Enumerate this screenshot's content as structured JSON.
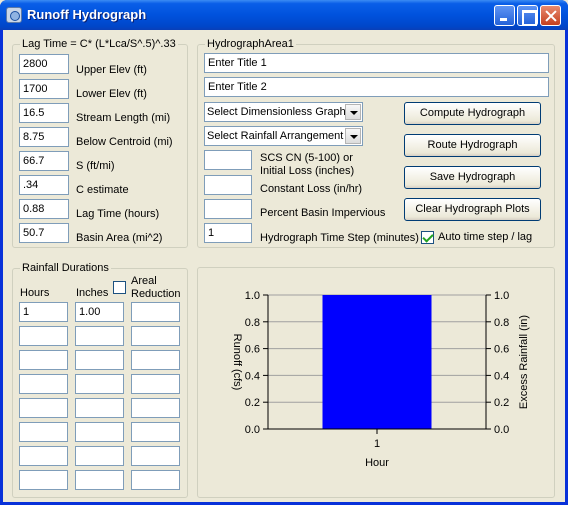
{
  "window": {
    "title": "Runoff Hydrograph"
  },
  "lag_group": {
    "legend": "Lag Time = C* (L*Lca/S^.5)^.33",
    "rows": [
      {
        "value": "2800",
        "label": "Upper Elev (ft)"
      },
      {
        "value": "1700",
        "label": "Lower Elev (ft)"
      },
      {
        "value": "16.5",
        "label": "Stream Length (mi)"
      },
      {
        "value": "8.75",
        "label": "Below Centroid (mi)"
      },
      {
        "value": "66.7",
        "label": "S (ft/mi)"
      },
      {
        "value": ".34",
        "label": "C estimate"
      },
      {
        "value": "0.88",
        "label": "Lag Time (hours)"
      },
      {
        "value": "50.7",
        "label": "Basin Area (mi^2)"
      }
    ]
  },
  "hydro_group": {
    "legend": "HydrographArea1",
    "title1": "Enter Title 1",
    "title2": "Enter Title 2",
    "dim_graph": "Select Dimensionless Graph",
    "rain_arr": "Select Rainfall Arrangement",
    "scs_label_1": "SCS CN (5-100) or",
    "scs_label_2": "Initial Loss (inches)",
    "scs_value": "",
    "const_loss_label": "Constant Loss (in/hr)",
    "const_loss_value": "",
    "impervious_label": "Percent Basin Impervious",
    "impervious_value": "",
    "timestep_label": "Hydrograph Time Step (minutes)",
    "timestep_value": "1",
    "auto_timestep_label": "Auto time step / lag",
    "auto_timestep_checked": true,
    "buttons": {
      "compute": "Compute Hydrograph",
      "route": "Route Hydrograph",
      "save": "Save Hydrograph",
      "clear": "Clear Hydrograph Plots"
    }
  },
  "rain_group": {
    "legend": "Rainfall Durations",
    "col_hours": "Hours",
    "col_inches": "Inches",
    "areal_label_1": "Areal",
    "areal_label_2": "Reduction",
    "areal_checked": false,
    "rows": [
      [
        "1",
        "1.00",
        ""
      ],
      [
        "",
        "",
        ""
      ],
      [
        "",
        "",
        ""
      ],
      [
        "",
        "",
        ""
      ],
      [
        "",
        "",
        ""
      ],
      [
        "",
        "",
        ""
      ],
      [
        "",
        "",
        ""
      ],
      [
        "",
        "",
        ""
      ]
    ]
  },
  "chart_data": {
    "type": "bar",
    "categories": [
      "1"
    ],
    "series": [
      {
        "values": [
          1.0
        ],
        "color": "#0000ff"
      }
    ],
    "xlabel": "Hour",
    "ylabel": "Runoff (cfs)",
    "y2label": "Excess Rainfall (in)",
    "ylim": [
      0,
      1
    ],
    "y_ticks": [
      "0.0",
      "0.2",
      "0.4",
      "0.6",
      "0.8",
      "1.0"
    ],
    "y2_ticks": [
      "0.0",
      "0.2",
      "0.4",
      "0.6",
      "0.8",
      "1.0"
    ],
    "grid": true
  }
}
